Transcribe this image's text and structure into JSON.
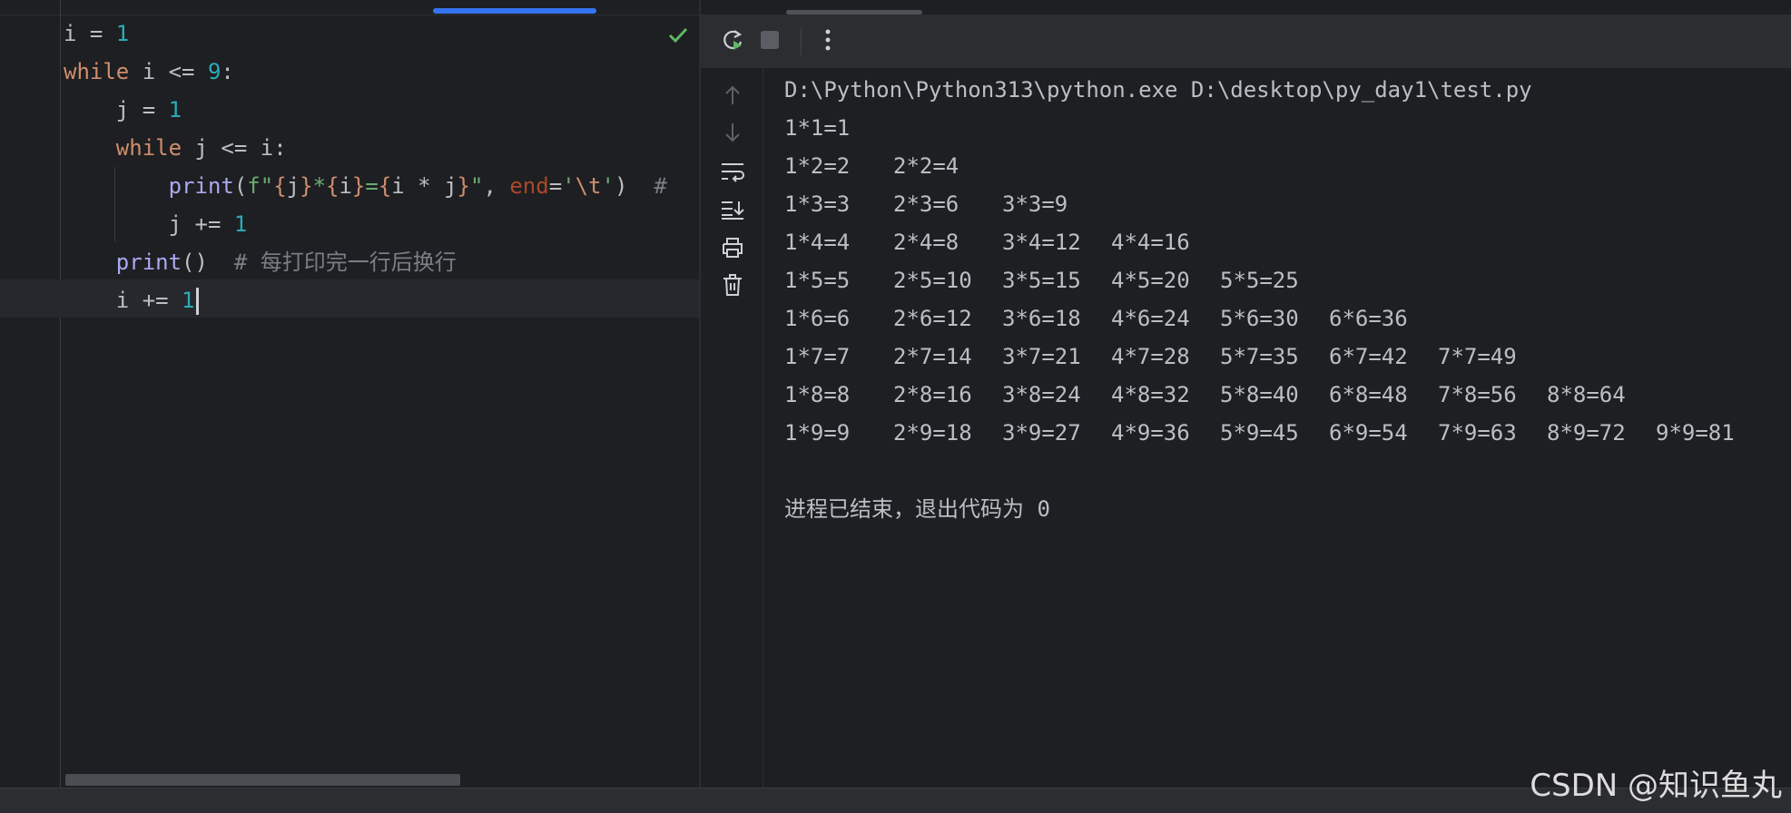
{
  "editor": {
    "code_lines": [
      [
        {
          "t": "i = ",
          "c": ""
        },
        {
          "t": "1",
          "c": "num"
        }
      ],
      [
        {
          "t": "while",
          "c": "kw"
        },
        {
          "t": " i <= ",
          "c": ""
        },
        {
          "t": "9",
          "c": "num"
        },
        {
          "t": ":",
          "c": ""
        }
      ],
      [
        {
          "t": "    j = ",
          "c": ""
        },
        {
          "t": "1",
          "c": "num"
        }
      ],
      [
        {
          "t": "    ",
          "c": ""
        },
        {
          "t": "while",
          "c": "kw"
        },
        {
          "t": " j <= i:",
          "c": ""
        }
      ],
      [
        {
          "t": "        ",
          "c": ""
        },
        {
          "t": "print",
          "c": "fn"
        },
        {
          "t": "(",
          "c": ""
        },
        {
          "t": "f\"",
          "c": "str"
        },
        {
          "t": "{",
          "c": "esc"
        },
        {
          "t": "j",
          "c": ""
        },
        {
          "t": "}",
          "c": "esc"
        },
        {
          "t": "*",
          "c": "str"
        },
        {
          "t": "{",
          "c": "esc"
        },
        {
          "t": "i",
          "c": ""
        },
        {
          "t": "}",
          "c": "esc"
        },
        {
          "t": "=",
          "c": "str"
        },
        {
          "t": "{",
          "c": "esc"
        },
        {
          "t": "i * j",
          "c": ""
        },
        {
          "t": "}",
          "c": "esc"
        },
        {
          "t": "\"",
          "c": "str"
        },
        {
          "t": ", ",
          "c": ""
        },
        {
          "t": "end",
          "c": "param"
        },
        {
          "t": "=",
          "c": ""
        },
        {
          "t": "'",
          "c": "str"
        },
        {
          "t": "\\t",
          "c": "esc"
        },
        {
          "t": "'",
          "c": "str"
        },
        {
          "t": ")  ",
          "c": ""
        },
        {
          "t": "#",
          "c": "cmt"
        }
      ],
      [
        {
          "t": "        j += ",
          "c": ""
        },
        {
          "t": "1",
          "c": "num"
        }
      ],
      [
        {
          "t": "    ",
          "c": ""
        },
        {
          "t": "print",
          "c": "fn"
        },
        {
          "t": "()  ",
          "c": ""
        },
        {
          "t": "# 每打印完一行后换行",
          "c": "cmt"
        }
      ],
      [
        {
          "t": "    i += ",
          "c": ""
        },
        {
          "t": "1",
          "c": "num"
        }
      ]
    ],
    "status_icon": "checkmark-icon",
    "colors": {
      "keyword": "#cf8e6d",
      "number": "#2aacb8",
      "function": "#a9a9f0",
      "string": "#6aab73",
      "comment": "#7a7e85",
      "accent": "#3574f0"
    }
  },
  "run_toolbar": {
    "buttons": [
      {
        "name": "rerun-button",
        "icon": "rerun-icon"
      },
      {
        "name": "stop-button",
        "icon": "stop-icon"
      },
      {
        "name": "more-options-button",
        "icon": "more-vertical-icon"
      }
    ]
  },
  "side_toolbar": {
    "buttons": [
      {
        "name": "up-arrow-button",
        "icon": "arrow-up-icon"
      },
      {
        "name": "down-arrow-button",
        "icon": "arrow-down-icon"
      },
      {
        "name": "soft-wrap-button",
        "icon": "soft-wrap-icon"
      },
      {
        "name": "scroll-to-end-button",
        "icon": "scroll-to-end-icon"
      },
      {
        "name": "print-button",
        "icon": "printer-icon"
      },
      {
        "name": "clear-all-button",
        "icon": "trash-icon"
      }
    ]
  },
  "console": {
    "command": "D:\\Python\\Python313\\python.exe D:\\desktop\\py_day1\\test.py",
    "rows": [
      [
        "1*1=1"
      ],
      [
        "1*2=2",
        "2*2=4"
      ],
      [
        "1*3=3",
        "2*3=6",
        "3*3=9"
      ],
      [
        "1*4=4",
        "2*4=8",
        "3*4=12",
        "4*4=16"
      ],
      [
        "1*5=5",
        "2*5=10",
        "3*5=15",
        "4*5=20",
        "5*5=25"
      ],
      [
        "1*6=6",
        "2*6=12",
        "3*6=18",
        "4*6=24",
        "5*6=30",
        "6*6=36"
      ],
      [
        "1*7=7",
        "2*7=14",
        "3*7=21",
        "4*7=28",
        "5*7=35",
        "6*7=42",
        "7*7=49"
      ],
      [
        "1*8=8",
        "2*8=16",
        "3*8=24",
        "4*8=32",
        "5*8=40",
        "6*8=48",
        "7*8=56",
        "8*8=64"
      ],
      [
        "1*9=9",
        "2*9=18",
        "3*9=27",
        "4*9=36",
        "5*9=45",
        "6*9=54",
        "7*9=63",
        "8*9=72",
        "9*9=81"
      ]
    ],
    "exit_message": "进程已结束，退出代码为 0"
  },
  "watermark": "CSDN @知识鱼丸"
}
